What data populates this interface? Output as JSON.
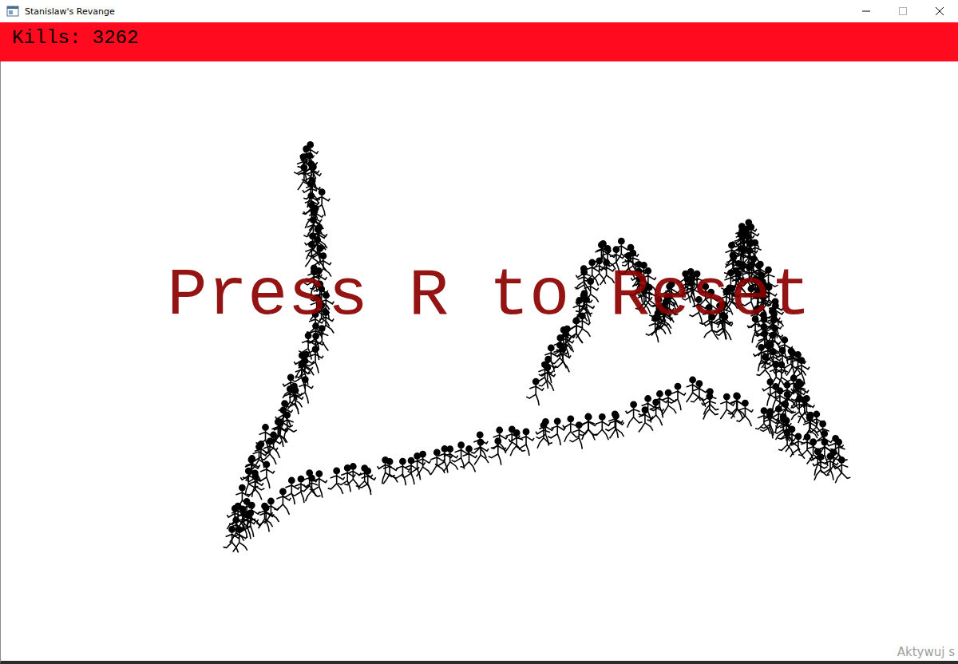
{
  "window": {
    "title": "Stanislaw's Revange"
  },
  "hud": {
    "kills": "Kills: 3262"
  },
  "overlay": {
    "message": "Press R to Reset"
  },
  "watermark": {
    "text": "Aktywuj s"
  }
}
